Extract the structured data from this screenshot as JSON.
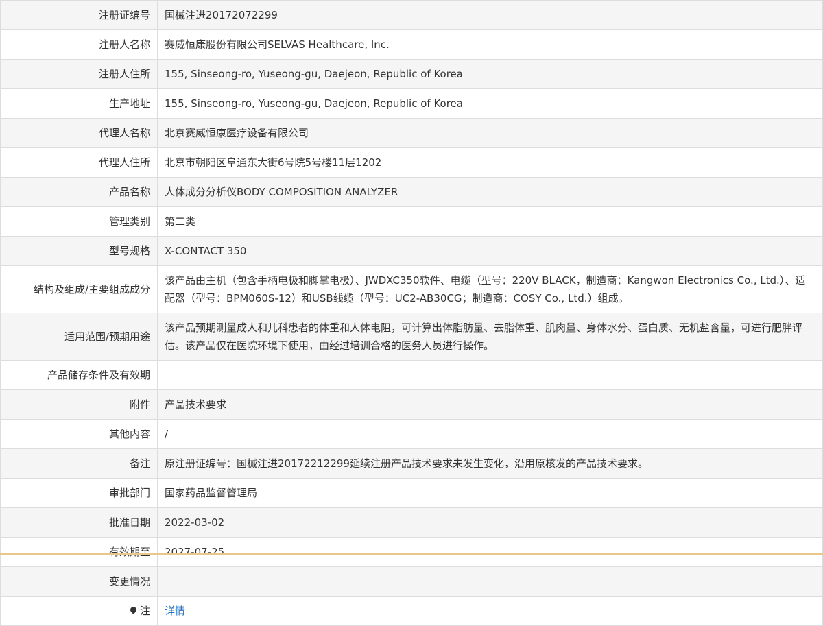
{
  "rows": [
    {
      "label": "注册证编号",
      "value": "国械注进20172072299"
    },
    {
      "label": "注册人名称",
      "value": "赛威恒康股份有限公司SELVAS Healthcare, Inc."
    },
    {
      "label": "注册人住所",
      "value": "155, Sinseong-ro, Yuseong-gu, Daejeon, Republic of Korea"
    },
    {
      "label": "生产地址",
      "value": "155, Sinseong-ro, Yuseong-gu, Daejeon, Republic of Korea"
    },
    {
      "label": "代理人名称",
      "value": "北京赛威恒康医疗设备有限公司"
    },
    {
      "label": "代理人住所",
      "value": "北京市朝阳区阜通东大街6号院5号楼11层1202"
    },
    {
      "label": "产品名称",
      "value": "人体成分分析仪BODY COMPOSITION ANALYZER"
    },
    {
      "label": "管理类别",
      "value": "第二类"
    },
    {
      "label": "型号规格",
      "value": "X-CONTACT 350"
    },
    {
      "label": "结构及组成/主要组成成分",
      "value": "该产品由主机（包含手柄电极和脚掌电极）、JWDXC350软件、电缆（型号：220V BLACK，制造商：Kangwon Electronics Co., Ltd.）、适配器（型号：BPM060S-12）和USB线缆（型号：UC2-AB30CG；制造商：COSY Co., Ltd.）组成。"
    },
    {
      "label": "适用范围/预期用途",
      "value": "该产品预期测量成人和儿科患者的体重和人体电阻，可计算出体脂肪量、去脂体重、肌肉量、身体水分、蛋白质、无机盐含量，可进行肥胖评估。该产品仅在医院环境下使用，由经过培训合格的医务人员进行操作。"
    },
    {
      "label": "产品储存条件及有效期",
      "value": ""
    },
    {
      "label": "附件",
      "value": "产品技术要求"
    },
    {
      "label": "其他内容",
      "value": "/"
    },
    {
      "label": "备注",
      "value": "原注册证编号：国械注进20172212299延续注册产品技术要求未发生变化，沿用原核发的产品技术要求。"
    },
    {
      "label": "审批部门",
      "value": "国家药品监督管理局"
    },
    {
      "label": "批准日期",
      "value": "2022-03-02"
    },
    {
      "label": "有效期至",
      "value": "2027-07-25"
    },
    {
      "label": "变更情况",
      "value": ""
    }
  ],
  "note": {
    "label": "注",
    "link": "详情",
    "icon": "pin-icon"
  }
}
